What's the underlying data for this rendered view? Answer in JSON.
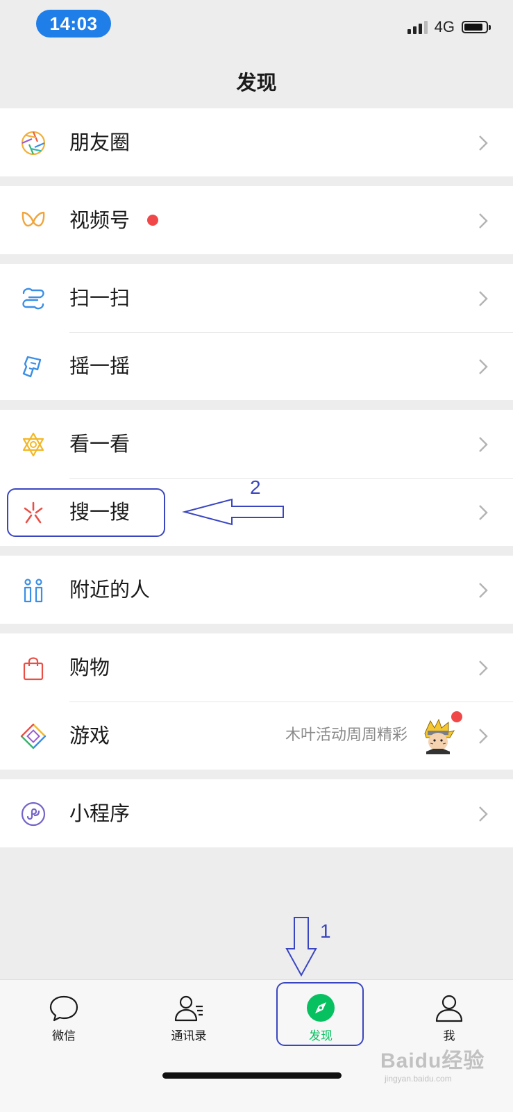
{
  "status_bar": {
    "time": "14:03",
    "network": "4G"
  },
  "page_title": "发现",
  "groups": [
    {
      "items": [
        {
          "label": "朋友圈",
          "icon": "moments-icon"
        }
      ]
    },
    {
      "items": [
        {
          "label": "视频号",
          "icon": "channels-icon",
          "badge": "red-dot"
        }
      ]
    },
    {
      "items": [
        {
          "label": "扫一扫",
          "icon": "scan-icon"
        },
        {
          "label": "摇一摇",
          "icon": "shake-icon"
        }
      ]
    },
    {
      "items": [
        {
          "label": "看一看",
          "icon": "top-stories-icon"
        },
        {
          "label": "搜一搜",
          "icon": "search-icon"
        }
      ]
    },
    {
      "items": [
        {
          "label": "附近的人",
          "icon": "people-nearby-icon"
        }
      ]
    },
    {
      "items": [
        {
          "label": "购物",
          "icon": "shopping-bag-icon"
        },
        {
          "label": "游戏",
          "icon": "games-icon",
          "subtitle": "木叶活动周周精彩",
          "badge": "red-dot"
        }
      ]
    },
    {
      "items": [
        {
          "label": "小程序",
          "icon": "mini-programs-icon"
        }
      ]
    }
  ],
  "annotations": {
    "arrow_1_number": "1",
    "arrow_2_number": "2"
  },
  "tabbar": {
    "tabs": [
      {
        "label": "微信",
        "icon": "chat-bubble-icon"
      },
      {
        "label": "通讯录",
        "icon": "contacts-icon"
      },
      {
        "label": "发现",
        "icon": "compass-icon",
        "active": true
      },
      {
        "label": "我",
        "icon": "person-icon"
      }
    ]
  },
  "watermark": {
    "main": "Baidu经验",
    "sub": "jingyan.baidu.com"
  },
  "colors": {
    "accent": "#07c160",
    "badge": "#f04848",
    "annotation": "#3a46c0",
    "time_pill": "#1f7ee8"
  }
}
